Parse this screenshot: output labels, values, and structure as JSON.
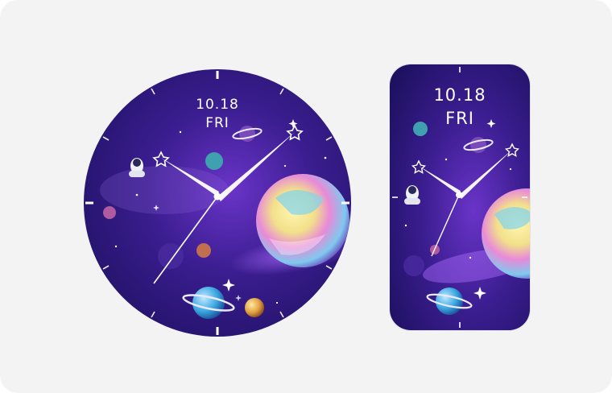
{
  "preview": {
    "round": {
      "date": "10.18",
      "day": "FRI"
    },
    "rectangular": {
      "date": "10.18",
      "day": "FRI"
    }
  },
  "theme": {
    "card_background": "#f3f3f4",
    "space_dark": "#2a1a6e",
    "space_purple": "#5a2bb0",
    "planet_pink": "#e96fd6",
    "planet_yellow": "#f4e08a",
    "planet_cyan": "#7fd3f0"
  },
  "icons": [
    "astronaut-icon",
    "star-icon",
    "planet-icon",
    "sparkle-icon"
  ]
}
